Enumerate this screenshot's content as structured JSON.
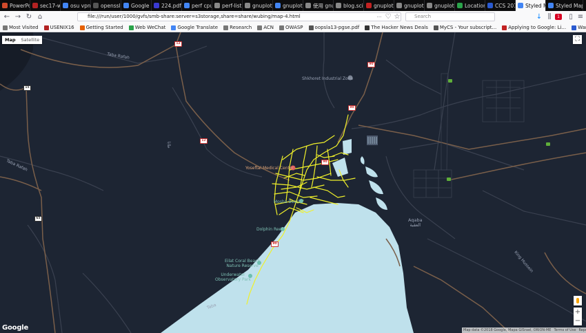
{
  "tabs": [
    {
      "label": "PowerPo",
      "color": "#d04a2b",
      "active": false
    },
    {
      "label": "sec17-w",
      "color": "#b22222",
      "active": false
    },
    {
      "label": "osu vpn",
      "color": "#4285f4",
      "active": false
    },
    {
      "label": "openssl",
      "color": "#555555",
      "active": false
    },
    {
      "label": "Google",
      "color": "#4285f4",
      "active": false
    },
    {
      "label": "224.pdf",
      "color": "#3a3ad0",
      "active": false
    },
    {
      "label": "perf cpu",
      "color": "#4285f4",
      "active": false
    },
    {
      "label": "perf-list(1)",
      "color": "#888888",
      "active": false
    },
    {
      "label": "gnuplot de",
      "color": "#888888",
      "active": false
    },
    {
      "label": "gnuplot",
      "color": "#4285f4",
      "active": false
    },
    {
      "label": "使用 gnupl",
      "color": "#888888",
      "active": false
    },
    {
      "label": "blog.scienc",
      "color": "#888888",
      "active": false
    },
    {
      "label": "gnuplot",
      "color": "#c22222",
      "active": false
    },
    {
      "label": "gnuplot de",
      "color": "#888888",
      "active": false
    },
    {
      "label": "gnuplot.so",
      "color": "#888888",
      "active": false
    },
    {
      "label": "Location",
      "color": "#2aa34a",
      "active": false
    },
    {
      "label": "CCS 201",
      "color": "#2a5ad0",
      "active": false
    },
    {
      "label": "Styled M",
      "color": "#4285f4",
      "active": true
    },
    {
      "label": "Styled Map",
      "color": "#4285f4",
      "active": false
    }
  ],
  "nav": {
    "back": "←",
    "forward": "→",
    "reload": "↻",
    "home": "⌂",
    "url": "file:///run/user/1000/gvfs/smb-share:server=s3storage,share=share/wubing/map-4.html",
    "search_placeholder": "Search",
    "menu_icon": "≡",
    "more_icon": "···",
    "bookmark_star": "☆",
    "pocket": "♡",
    "download_icon": "↓",
    "library_icon": "⫼",
    "notif_count": "1"
  },
  "bookmarks": [
    {
      "label": "Most Visited",
      "color": "#777777"
    },
    {
      "label": "USENIX16",
      "color": "#b22222"
    },
    {
      "label": "Getting Started",
      "color": "#e66000"
    },
    {
      "label": "Web WeChat",
      "color": "#2aa34a"
    },
    {
      "label": "Google Translate",
      "color": "#4285f4"
    },
    {
      "label": "Research",
      "color": "#777777"
    },
    {
      "label": "ACN",
      "color": "#777777"
    },
    {
      "label": "OWASP",
      "color": "#777777"
    },
    {
      "label": "oopsla13-pgse.pdf",
      "color": "#555555"
    },
    {
      "label": "The Hacker News Deals",
      "color": "#333333"
    },
    {
      "label": "MyCS - Your subscript...",
      "color": "#555555"
    },
    {
      "label": "Applying to Google: Li...",
      "color": "#c22222"
    },
    {
      "label": "Wang, Wubing - Outlo...",
      "color": "#2a5ad0"
    }
  ],
  "map": {
    "type_map": "Map",
    "type_satellite": "Satellite",
    "fullscreen_icon": "⛶",
    "zoom_in": "+",
    "zoom_out": "−",
    "logo": "Google",
    "attribution": [
      "Map data ©2018 Google, Mapa GISrael, ORION-ME",
      "Terms of Use",
      "Report a map error"
    ],
    "labels": {
      "route12": "12",
      "route90a": "90",
      "route90b": "90",
      "route90c": "90",
      "route90d": "90",
      "route12b": "12",
      "tabaRd": "Taba Rafah",
      "tabaRd2": "Taba Rafah",
      "industrial": "Shkhoret Industrial Zone",
      "yoseftal": "Yoseftal Medical Center",
      "mosha": "Mosha Beach",
      "dolphin": "Dolphin Reef",
      "coralA": "Eilat Coral Beach",
      "coralB": "Nature Reserve",
      "observA": "Underwater",
      "observB": "Observatory Park",
      "aqaba": "Aqaba",
      "aqabaAr": "العقبة",
      "tabaCross": "Taba",
      "arabicNW": "طابا",
      "kingHussein": "King Hussein",
      "r65": "65",
      "r15": "15"
    },
    "colors": {
      "background": "#1d2533",
      "water": "#bfe1ec",
      "road": "#3a4150",
      "highway": "#7a5f4a",
      "highlight": "#f0f02a",
      "poi_park": "#6ebfb0",
      "poi_medical": "#e06060"
    }
  }
}
